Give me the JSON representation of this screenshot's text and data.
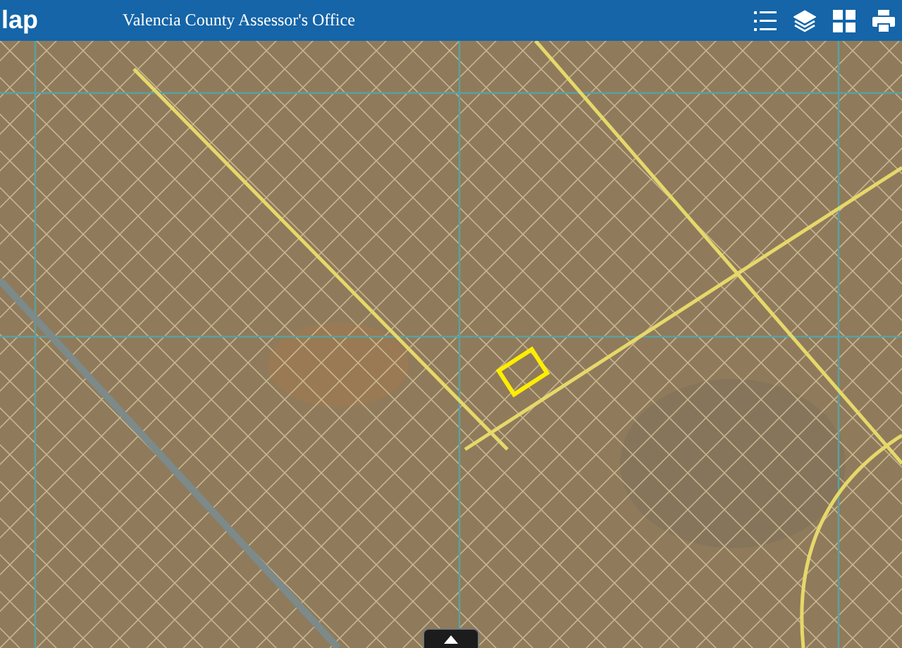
{
  "header": {
    "app_title": "lap",
    "subtitle": "Valencia County Assessor's Office"
  }
}
